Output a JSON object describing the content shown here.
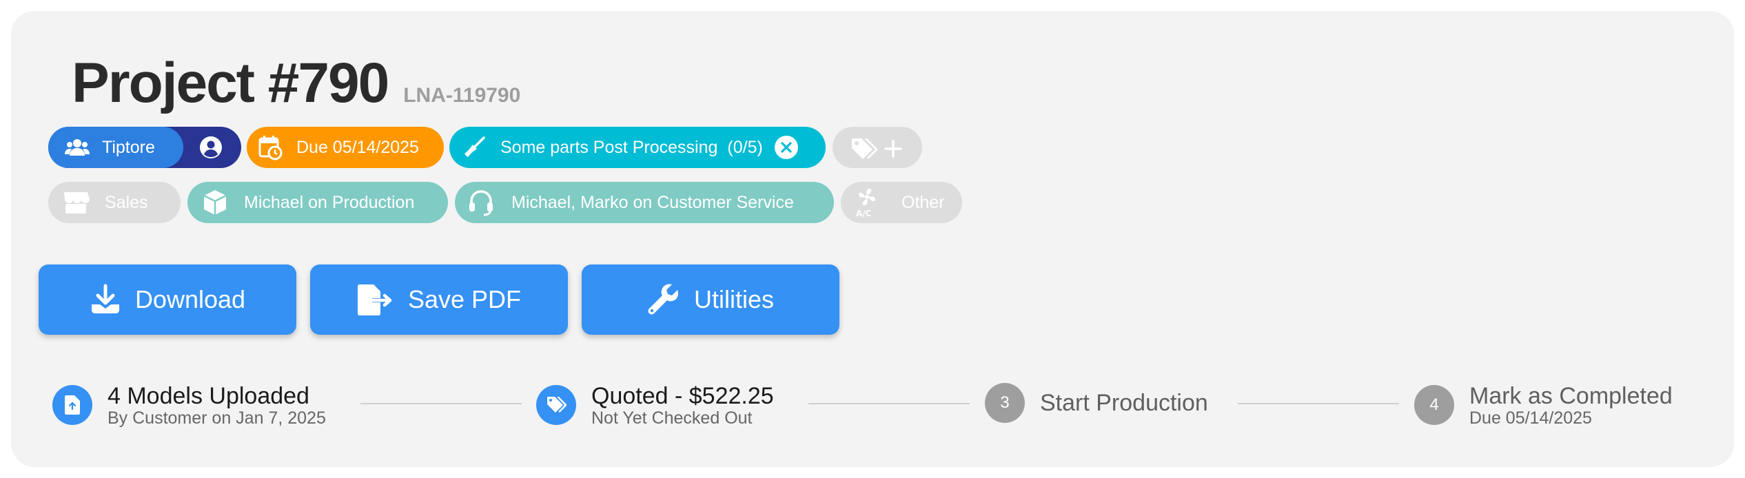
{
  "project": {
    "title": "Project #790",
    "code": "LNA-119790"
  },
  "chips_row1": {
    "team": "Tiptore",
    "due": "Due 05/14/2025",
    "processing": "Some parts Post Processing",
    "processing_count": "(0/5)"
  },
  "chips_row2": {
    "sales": "Sales",
    "production": "Michael on Production",
    "customer_service": "Michael, Marko on Customer Service",
    "other": "Other"
  },
  "actions": {
    "download": "Download",
    "save_pdf": "Save PDF",
    "utilities": "Utilities"
  },
  "steps": [
    {
      "main": "4 Models Uploaded",
      "sub": "By Customer on Jan 7, 2025",
      "status": "done"
    },
    {
      "main": "Quoted - $522.25",
      "sub": "Not Yet Checked Out",
      "status": "done"
    },
    {
      "number": "3",
      "main": "Start Production",
      "sub": "",
      "status": "pending"
    },
    {
      "number": "4",
      "main": "Mark as Completed",
      "sub": "Due 05/14/2025",
      "status": "pending"
    }
  ],
  "icons": {
    "team": "users-icon",
    "account": "user-circle-icon",
    "due": "calendar-clock-icon",
    "processing": "broom-icon",
    "clear": "close-circle-icon",
    "tags": "tags-plus-icon",
    "sales": "store-icon",
    "production": "box-icon",
    "customer_service": "headset-icon",
    "other": "fan-ac-icon",
    "download": "download-icon",
    "save_pdf": "file-export-icon",
    "utilities": "wrench-icon",
    "upload": "file-upload-icon",
    "quote": "tags-icon"
  },
  "colors": {
    "primary": "#3591f3",
    "team_chip": "#2d7fe0",
    "account_chip": "#283593",
    "due_chip": "#ff9800",
    "processing_chip": "#00bcd4",
    "assigned_chip": "#80cbc4",
    "inactive_chip": "#dddddd",
    "step_pending": "#9e9e9e"
  }
}
